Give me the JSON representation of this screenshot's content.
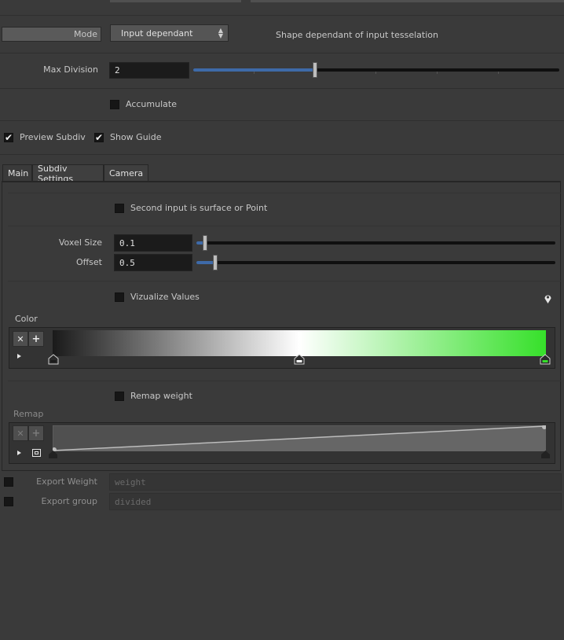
{
  "mode": {
    "label": "Mode",
    "value": "Input dependant",
    "description": "Shape dependant of input tesselation"
  },
  "max_division": {
    "label": "Max Division",
    "value": "2",
    "level": 0.31
  },
  "accumulate": {
    "label": "Accumulate",
    "checked": false
  },
  "preview_subdiv": {
    "label": "Preview Subdiv",
    "checked": true
  },
  "show_guide": {
    "label": "Show Guide",
    "checked": true
  },
  "tabs": [
    {
      "label": "Main",
      "active": true
    },
    {
      "label": "Subdiv Settings",
      "active": false
    },
    {
      "label": "Camera",
      "active": false
    }
  ],
  "second_input": {
    "label": "Second input is surface or Point",
    "checked": false
  },
  "voxel_size": {
    "label": "Voxel Size",
    "value": "0.1"
  },
  "offset": {
    "label": "Offset",
    "value": "0.5"
  },
  "visualize": {
    "label": "Vizualize Values",
    "checked": false
  },
  "color_ramp": {
    "label": "Color",
    "stops": [
      "#1a1a1a",
      "#ffffff",
      "#36e02a"
    ]
  },
  "remap_weight": {
    "label": "Remap weight",
    "checked": false
  },
  "remap_ramp": {
    "label": "Remap"
  },
  "export_weight": {
    "label": "Export Weight",
    "value": "weight",
    "checked": false
  },
  "export_group": {
    "label": "Export group",
    "value": "divided",
    "checked": false
  },
  "icons": {
    "pin": "pin-icon",
    "remove": "x-icon",
    "add": "plus-icon",
    "play": "play-icon",
    "expand": "frame-icon",
    "spinner": "updown-arrow-icon"
  },
  "colors": {
    "background": "#3a3a3a",
    "field": "#1b1b1b",
    "slider_fill": "#3e6aa8",
    "ramp_green": "#36e02a"
  }
}
